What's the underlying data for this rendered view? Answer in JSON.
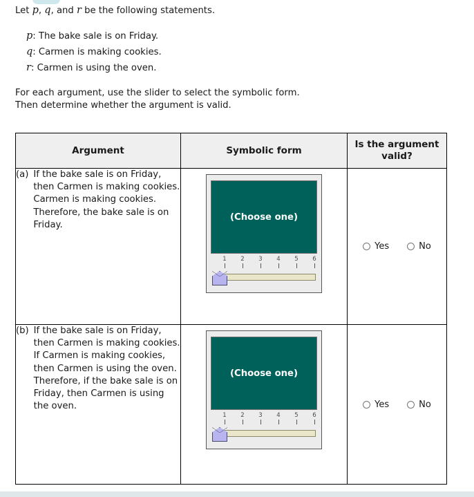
{
  "intro": {
    "prefix": "Let ",
    "var_p": "p",
    "sep1": ", ",
    "var_q": "q",
    "sep2": ", and ",
    "var_r": "r",
    "suffix": " be the following statements."
  },
  "statements": [
    {
      "var": "p",
      "text": ": The bake sale is on Friday."
    },
    {
      "var": "q",
      "text": ": Carmen is making cookies."
    },
    {
      "var": "r",
      "text": ": Carmen is using the oven."
    }
  ],
  "instructions": {
    "line1": "For each argument, use the slider to select the symbolic form.",
    "line2": "Then determine whether the argument is valid."
  },
  "table": {
    "headers": {
      "argument": "Argument",
      "symbolic_form": "Symbolic form",
      "valid_line1": "Is the argument",
      "valid_line2": "valid?"
    },
    "rows": [
      {
        "label": "(a)",
        "text": "If the bake sale is on Friday, then Carmen is making cookies. Carmen is making cookies. Therefore, the bake sale is on Friday.",
        "slider": {
          "display_value": "(Choose one)",
          "ticks": [
            "1",
            "2",
            "3",
            "4",
            "5",
            "6"
          ],
          "handle_position": 0
        },
        "radios": [
          {
            "label": "Yes",
            "selected": false
          },
          {
            "label": "No",
            "selected": false
          }
        ]
      },
      {
        "label": "(b)",
        "text": "If the bake sale is on Friday, then Carmen is making cookies. If Carmen is making cookies, then Carmen is using the oven. Therefore, if the bake sale is on Friday, then Carmen is using the oven.",
        "slider": {
          "display_value": "(Choose one)",
          "ticks": [
            "1",
            "2",
            "3",
            "4",
            "5",
            "6"
          ],
          "handle_position": 0
        },
        "radios": [
          {
            "label": "Yes",
            "selected": false
          },
          {
            "label": "No",
            "selected": false
          }
        ]
      }
    ]
  },
  "colors": {
    "display_background": "#00615b",
    "handle": "#b8b4f0",
    "track": "#e9e6c9",
    "header_background": "#efefef",
    "top_pill": "#cfe8ee"
  }
}
